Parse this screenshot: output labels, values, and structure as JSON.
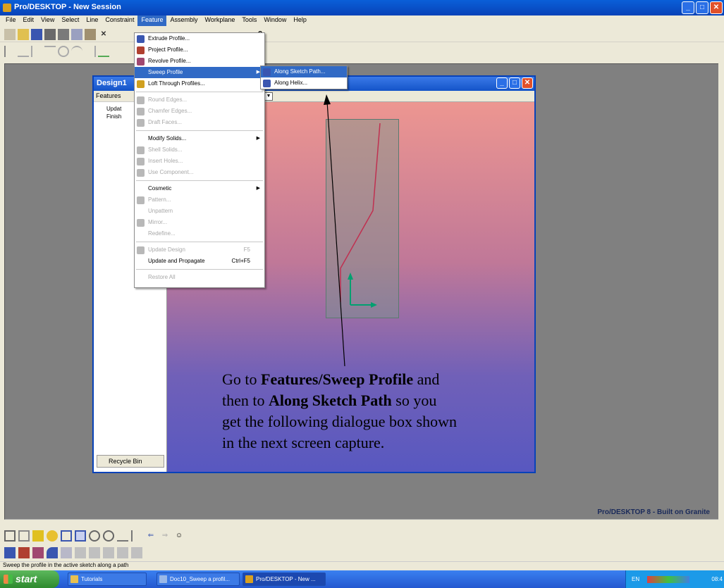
{
  "window": {
    "title": "Pro/DESKTOP - New Session"
  },
  "menubar": [
    "File",
    "Edit",
    "View",
    "Select",
    "Line",
    "Constraint",
    "Feature",
    "Assembly",
    "Workplane",
    "Tools",
    "Window",
    "Help"
  ],
  "active_menu": "Feature",
  "feature_menu": {
    "items": [
      {
        "label": "Extrude Profile...",
        "icon": "extrude-icon",
        "color": "#3a56b0"
      },
      {
        "label": "Project Profile...",
        "icon": "project-icon",
        "color": "#b04030"
      },
      {
        "label": "Revolve Profile...",
        "icon": "revolve-icon",
        "color": "#a04870"
      },
      {
        "label": "Sweep Profile",
        "icon": "",
        "submenu": true,
        "highlighted": true
      },
      {
        "label": "Loft Through Profiles...",
        "icon": "loft-icon",
        "color": "#d0a020"
      },
      {
        "sep": true
      },
      {
        "label": "Round Edges...",
        "icon": "round-icon",
        "disabled": true,
        "color": "#b8b8b8"
      },
      {
        "label": "Chamfer Edges...",
        "icon": "chamfer-icon",
        "disabled": true,
        "color": "#b8b8b8"
      },
      {
        "label": "Draft Faces...",
        "icon": "draft-icon",
        "disabled": true,
        "color": "#b8b8b8"
      },
      {
        "sep": true
      },
      {
        "label": "Modify Solids...",
        "icon": "",
        "submenu": true
      },
      {
        "label": "Shell Solids...",
        "icon": "shell-icon",
        "disabled": true,
        "color": "#b8b8b8"
      },
      {
        "label": "Insert Holes...",
        "icon": "hole-icon",
        "disabled": true,
        "color": "#b8b8b8"
      },
      {
        "label": "Use Component...",
        "icon": "component-icon",
        "disabled": true,
        "color": "#b8b8b8"
      },
      {
        "sep": true
      },
      {
        "label": "Cosmetic",
        "icon": "",
        "submenu": true
      },
      {
        "label": "Pattern...",
        "icon": "pattern-icon",
        "disabled": true,
        "color": "#b8b8b8"
      },
      {
        "label": "Unpattern",
        "icon": "",
        "disabled": true
      },
      {
        "label": "Mirror...",
        "icon": "mirror-icon",
        "disabled": true,
        "color": "#b8b8b8"
      },
      {
        "label": "Redefine...",
        "icon": "",
        "disabled": true
      },
      {
        "sep": true
      },
      {
        "label": "Update Design",
        "icon": "update-icon",
        "disabled": true,
        "shortcut": "F5",
        "color": "#b8b8b8"
      },
      {
        "label": "Update and Propagate",
        "icon": "",
        "shortcut": "Ctrl+F5"
      },
      {
        "sep": true
      },
      {
        "label": "Restore All",
        "icon": "",
        "disabled": true
      }
    ]
  },
  "sweep_submenu": {
    "items": [
      {
        "label": "Along Sketch Path...",
        "icon": "sketch-path-icon",
        "highlighted": true
      },
      {
        "label": "Along Helix...",
        "icon": "helix-icon"
      }
    ]
  },
  "child_window": {
    "title": "Design1"
  },
  "feature_panel": {
    "header": "Features",
    "items": [
      "Updat",
      "Finish"
    ],
    "recycle_bin": "Recycle Bin"
  },
  "annotation": {
    "line1_a": "Go to ",
    "line1_b": "Features/Sweep Profile",
    "line1_c": " and",
    "line2_a": "then to ",
    "line2_b": "Along Sketch Path",
    "line2_c": " so you",
    "line3": "get the following dialogue box shown",
    "line4": "in the next screen capture."
  },
  "brand": "Pro/DESKTOP 8 - Built on Granite",
  "status_text": "Sweep the profile in the active sketch along a path",
  "taskbar": {
    "start": "start",
    "tasks": [
      "Tutorials",
      "Doc10_Sweep a profil...",
      "Pro/DESKTOP - New ..."
    ],
    "tray_lang": "EN",
    "clock": "08:4"
  }
}
